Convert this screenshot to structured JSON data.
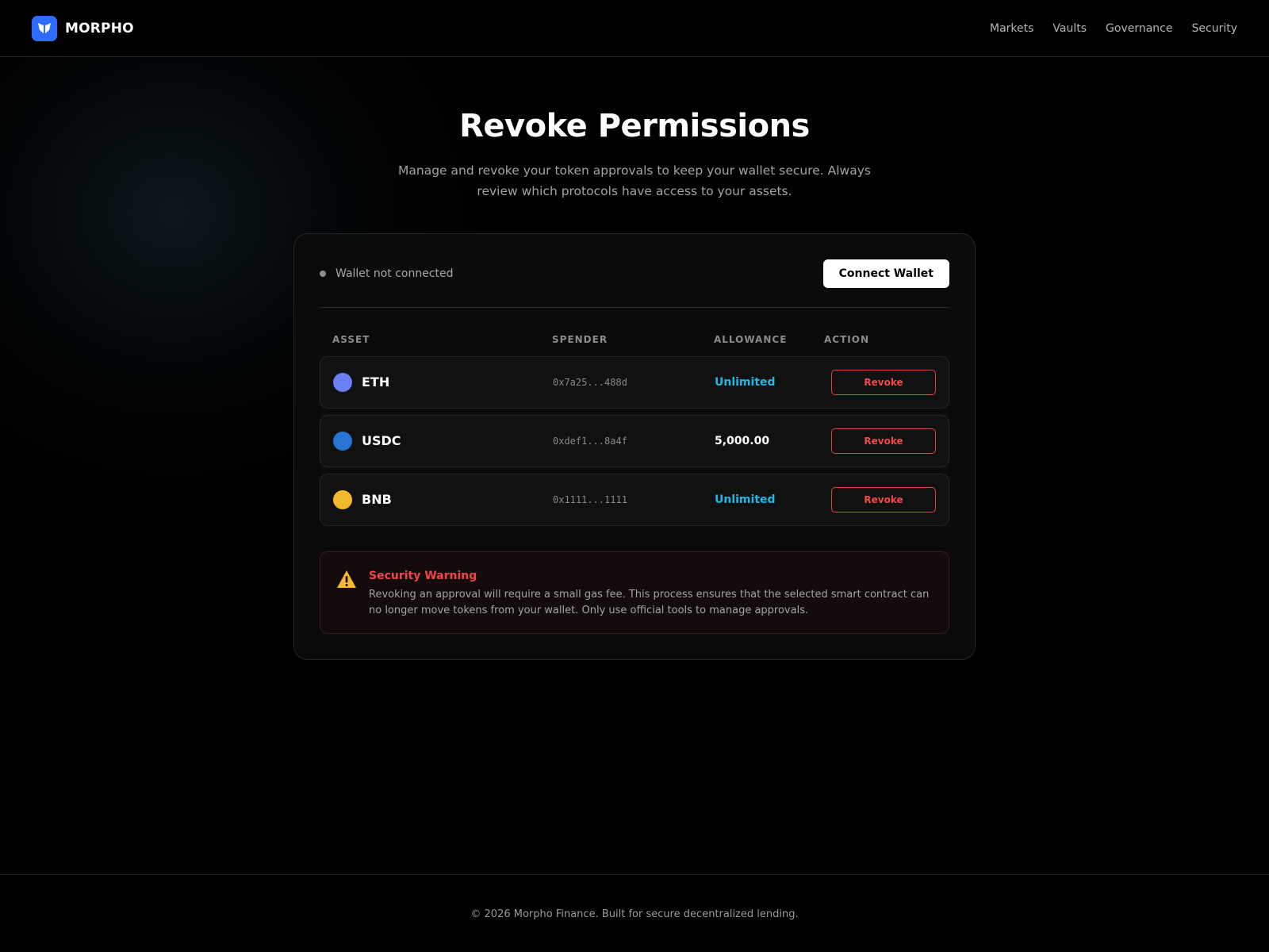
{
  "header": {
    "brand": "MORPHO",
    "nav": [
      "Markets",
      "Vaults",
      "Governance",
      "Security"
    ]
  },
  "hero": {
    "title": "Revoke Permissions",
    "subtitle": "Manage and revoke your token approvals to keep your wallet secure. Always review which protocols have access to your assets."
  },
  "wallet": {
    "status": "Wallet not connected",
    "connect_label": "Connect Wallet"
  },
  "table": {
    "columns": [
      "ASSET",
      "SPENDER",
      "ALLOWANCE",
      "ACTION"
    ],
    "rows": [
      {
        "asset": "ETH",
        "spender": "0x7a25...488d",
        "allowance": "Unlimited",
        "action": "Revoke",
        "color": "#6b7ef2",
        "allowance_color": "#22b8e6"
      },
      {
        "asset": "USDC",
        "spender": "0xdef1...8a4f",
        "allowance": "5,000.00",
        "action": "Revoke",
        "color": "#2b74d6",
        "allowance_color": "#ffffff"
      },
      {
        "asset": "BNB",
        "spender": "0x1111...1111",
        "allowance": "Unlimited",
        "action": "Revoke",
        "color": "#f2b92d",
        "allowance_color": "#22b8e6"
      }
    ]
  },
  "warning": {
    "title": "Security Warning",
    "text": "Revoking an approval will require a small gas fee. This process ensures that the selected smart contract can no longer move tokens from your wallet. Only use official tools to manage approvals."
  },
  "footer": {
    "text": "© 2026 Morpho Finance. Built for secure decentralized lending."
  },
  "colors": {
    "accent": "#2f6bff",
    "danger": "#ef4a47",
    "unlimited": "#22b8e6",
    "warning_icon": "#f5b82e"
  }
}
